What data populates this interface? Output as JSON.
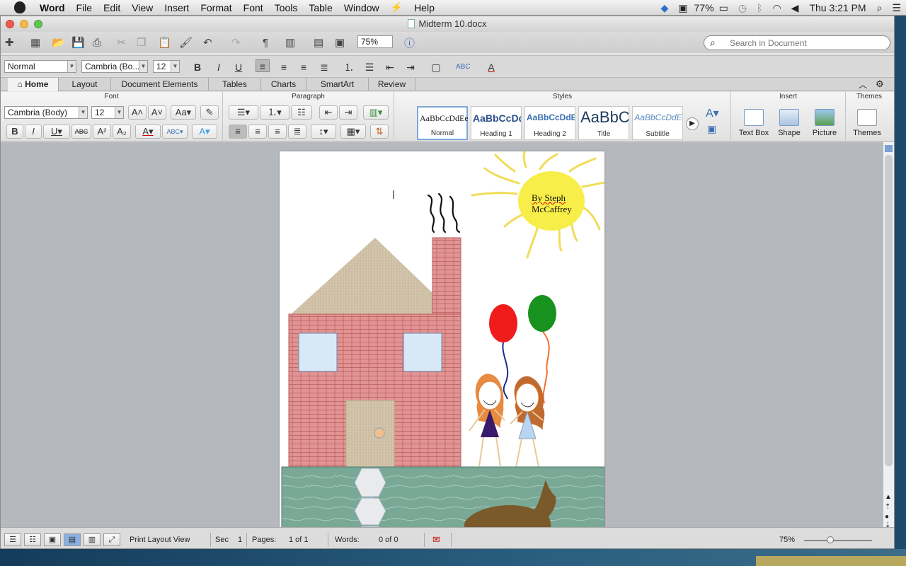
{
  "menubar": {
    "app": "Word",
    "items": [
      "File",
      "Edit",
      "View",
      "Insert",
      "Format",
      "Font",
      "Tools",
      "Table",
      "Window",
      "Help"
    ],
    "battery": "77%",
    "clock": "Thu 3:21 PM"
  },
  "window": {
    "title": "Midterm 10.docx"
  },
  "toolbar": {
    "zoom": "75%",
    "search_placeholder": "Search in Document"
  },
  "formatbar": {
    "style": "Normal",
    "font": "Cambria (Bo...",
    "size": "12",
    "bold": "B",
    "italic": "I",
    "underline": "U"
  },
  "ribbon": {
    "tabs": [
      "Home",
      "Layout",
      "Document Elements",
      "Tables",
      "Charts",
      "SmartArt",
      "Review"
    ],
    "groups": {
      "font": "Font",
      "paragraph": "Paragraph",
      "styles": "Styles",
      "insert": "Insert",
      "themes": "Themes"
    },
    "font_name": "Cambria (Body)",
    "font_size": "12",
    "styles": [
      {
        "preview": "AaBbCcDdEe",
        "name": "Normal"
      },
      {
        "preview": "AaBbCcDd",
        "name": "Heading 1"
      },
      {
        "preview": "AaBbCcDdEe",
        "name": "Heading 2"
      },
      {
        "preview": "AaBbC",
        "name": "Title"
      },
      {
        "preview": "AaBbCcDdE",
        "name": "Subtitle"
      }
    ],
    "insert": [
      {
        "label": "Text Box"
      },
      {
        "label": "Shape"
      },
      {
        "label": "Picture"
      }
    ],
    "themes_label": "Themes"
  },
  "document": {
    "sun_text_line1": "By Steph",
    "sun_text_line2": "McCaffrey"
  },
  "status": {
    "view": "Print Layout View",
    "sec_label": "Sec",
    "sec": "1",
    "pages_label": "Pages:",
    "pages": "1 of 1",
    "words_label": "Words:",
    "words": "0 of 0",
    "zoom": "75%"
  },
  "colors": {
    "accent": "#3a6fb3",
    "brick": "#e08a8a",
    "grass": "#6fa38e",
    "sun": "#f7ee4a"
  }
}
